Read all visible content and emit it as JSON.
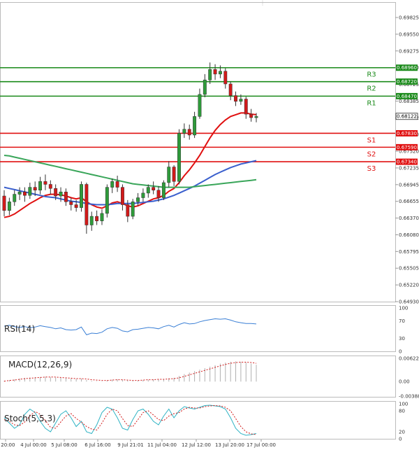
{
  "chart_data": {
    "type": "candlestick",
    "price_axis": {
      "ylim": [
        0.6493,
        0.69825
      ],
      "ticks": [
        "0.69825",
        "0.69550",
        "0.69275",
        "0.69000",
        "0.68725",
        "0.68385",
        "0.68122",
        "0.67860",
        "0.67520",
        "0.67235",
        "0.66945",
        "0.66655",
        "0.66370",
        "0.66080",
        "0.65795",
        "0.65505",
        "0.65220",
        "0.64930"
      ]
    },
    "x_ticks": [
      "n 20:00",
      "4 Jul 00:00",
      "5 Jul 08:00",
      "6 Jul 16:00",
      "9 Jul 21:01",
      "11 Jul 04:00",
      "12 Jul 12:00",
      "13 Jul 20:00",
      "17 Jul 00:00"
    ],
    "current_price": {
      "label": "0.68122",
      "value": 0.68122
    },
    "levels": [
      {
        "name": "R3",
        "value": 0.6896,
        "label": "0.68960",
        "color": "#1a8a1a"
      },
      {
        "name": "R2",
        "value": 0.6872,
        "label": "0.68720",
        "color": "#1a8a1a"
      },
      {
        "name": "R1",
        "value": 0.6847,
        "label": "0.68470",
        "color": "#1a8a1a"
      },
      {
        "name": "S1",
        "value": 0.6783,
        "label": "0.67830",
        "color": "#e01010"
      },
      {
        "name": "S2",
        "value": 0.6759,
        "label": "0.67590",
        "color": "#e01010"
      },
      {
        "name": "S3",
        "value": 0.6734,
        "label": "0.67340",
        "color": "#e01010"
      }
    ],
    "candles": [
      [
        0.6675,
        0.665,
        0.6685,
        0.664
      ],
      [
        0.665,
        0.6665,
        0.6672,
        0.6642
      ],
      [
        0.6665,
        0.6678,
        0.6685,
        0.6658
      ],
      [
        0.6678,
        0.6682,
        0.669,
        0.6668
      ],
      [
        0.6682,
        0.6676,
        0.669,
        0.6665
      ],
      [
        0.6676,
        0.669,
        0.6698,
        0.667
      ],
      [
        0.669,
        0.6685,
        0.67,
        0.6675
      ],
      [
        0.6685,
        0.67,
        0.6708,
        0.6678
      ],
      [
        0.67,
        0.6695,
        0.6712,
        0.6685
      ],
      [
        0.6695,
        0.6688,
        0.6702,
        0.6678
      ],
      [
        0.6688,
        0.6675,
        0.6695,
        0.6668
      ],
      [
        0.6675,
        0.6682,
        0.669,
        0.6665
      ],
      [
        0.6682,
        0.6665,
        0.6688,
        0.6658
      ],
      [
        0.6665,
        0.666,
        0.6672,
        0.665
      ],
      [
        0.666,
        0.6655,
        0.6668,
        0.6648
      ],
      [
        0.6655,
        0.6695,
        0.67,
        0.6648
      ],
      [
        0.6695,
        0.6625,
        0.6698,
        0.661
      ],
      [
        0.6625,
        0.664,
        0.6648,
        0.6615
      ],
      [
        0.664,
        0.6632,
        0.665,
        0.6625
      ],
      [
        0.6632,
        0.6645,
        0.6652,
        0.6625
      ],
      [
        0.6645,
        0.669,
        0.6695,
        0.6638
      ],
      [
        0.669,
        0.67,
        0.6705,
        0.668
      ],
      [
        0.67,
        0.669,
        0.671,
        0.6682
      ],
      [
        0.669,
        0.666,
        0.6695,
        0.665
      ],
      [
        0.666,
        0.664,
        0.6668,
        0.663
      ],
      [
        0.664,
        0.6665,
        0.667,
        0.6635
      ],
      [
        0.6665,
        0.6672,
        0.668,
        0.6658
      ],
      [
        0.6672,
        0.668,
        0.6688,
        0.6665
      ],
      [
        0.668,
        0.669,
        0.6695,
        0.6672
      ],
      [
        0.669,
        0.6685,
        0.67,
        0.6678
      ],
      [
        0.6685,
        0.6672,
        0.6692,
        0.6665
      ],
      [
        0.6672,
        0.6698,
        0.6702,
        0.6668
      ],
      [
        0.6698,
        0.6725,
        0.6735,
        0.669
      ],
      [
        0.6725,
        0.67,
        0.6728,
        0.6692
      ],
      [
        0.67,
        0.6783,
        0.679,
        0.6695
      ],
      [
        0.6783,
        0.679,
        0.68,
        0.6775
      ],
      [
        0.679,
        0.678,
        0.6798,
        0.6772
      ],
      [
        0.678,
        0.6812,
        0.682,
        0.6775
      ],
      [
        0.6812,
        0.685,
        0.686,
        0.6808
      ],
      [
        0.685,
        0.6875,
        0.6885,
        0.6845
      ],
      [
        0.6875,
        0.6893,
        0.6905,
        0.6868
      ],
      [
        0.6893,
        0.6885,
        0.6902,
        0.6875
      ],
      [
        0.6885,
        0.689,
        0.69,
        0.6878
      ],
      [
        0.689,
        0.6868,
        0.6895,
        0.686
      ],
      [
        0.6868,
        0.6848,
        0.6872,
        0.684
      ],
      [
        0.6848,
        0.6838,
        0.6855,
        0.683
      ],
      [
        0.6838,
        0.6842,
        0.685,
        0.6832
      ],
      [
        0.6842,
        0.6816,
        0.6846,
        0.6808
      ],
      [
        0.6816,
        0.681,
        0.6825,
        0.6803
      ],
      [
        0.681,
        0.6812,
        0.6818,
        0.6802
      ]
    ],
    "ma_series": [
      {
        "color": "#e01010",
        "values": [
          0.6638,
          0.664,
          0.6644,
          0.665,
          0.6656,
          0.6662,
          0.6667,
          0.6672,
          0.6676,
          0.6678,
          0.6678,
          0.6677,
          0.6675,
          0.6672,
          0.667,
          0.6672,
          0.6665,
          0.666,
          0.6656,
          0.6654,
          0.6658,
          0.6663,
          0.6665,
          0.6662,
          0.6658,
          0.6656,
          0.6658,
          0.6662,
          0.6666,
          0.667,
          0.6672,
          0.6676,
          0.6683,
          0.6688,
          0.6698,
          0.671,
          0.672,
          0.6732,
          0.6745,
          0.676,
          0.6775,
          0.6788,
          0.6798,
          0.6806,
          0.6812,
          0.6815,
          0.6818,
          0.6818,
          0.6816,
          0.6815
        ]
      },
      {
        "color": "#3a5fcd",
        "values": [
          0.669,
          0.6688,
          0.6686,
          0.6684,
          0.6682,
          0.668,
          0.6678,
          0.6676,
          0.6674,
          0.6673,
          0.6672,
          0.667,
          0.6668,
          0.6666,
          0.6665,
          0.6664,
          0.6662,
          0.6661,
          0.666,
          0.666,
          0.666,
          0.6661,
          0.6662,
          0.6662,
          0.6662,
          0.6662,
          0.6663,
          0.6664,
          0.6665,
          0.6666,
          0.6668,
          0.667,
          0.6673,
          0.6676,
          0.668,
          0.6684,
          0.6688,
          0.6692,
          0.6697,
          0.6702,
          0.6707,
          0.6712,
          0.6716,
          0.672,
          0.6724,
          0.6727,
          0.673,
          0.6732,
          0.6734,
          0.6736
        ]
      },
      {
        "color": "#3aa65a",
        "values": [
          0.6745,
          0.6744,
          0.6742,
          0.674,
          0.6738,
          0.6736,
          0.6734,
          0.6732,
          0.673,
          0.6728,
          0.6726,
          0.6724,
          0.6722,
          0.672,
          0.6718,
          0.6716,
          0.6714,
          0.6712,
          0.671,
          0.6708,
          0.6706,
          0.6704,
          0.6702,
          0.67,
          0.6698,
          0.6696,
          0.6695,
          0.6694,
          0.6693,
          0.6692,
          0.6691,
          0.669,
          0.669,
          0.669,
          0.669,
          0.669,
          0.669,
          0.6691,
          0.6692,
          0.6693,
          0.6694,
          0.6695,
          0.6696,
          0.6697,
          0.6698,
          0.6699,
          0.67,
          0.6701,
          0.6702,
          0.6703
        ]
      }
    ],
    "rsi": {
      "label": "RSI(14)",
      "ticks": [
        "100",
        "70",
        "30",
        "0"
      ],
      "values": [
        58,
        60,
        57,
        55,
        57,
        54,
        56,
        59,
        57,
        55,
        52,
        54,
        50,
        49,
        50,
        56,
        38,
        42,
        41,
        44,
        52,
        55,
        53,
        47,
        45,
        50,
        51,
        53,
        55,
        54,
        52,
        57,
        60,
        56,
        62,
        66,
        63,
        64,
        68,
        71,
        73,
        75,
        74,
        75,
        72,
        68,
        66,
        64,
        64,
        63
      ]
    },
    "macd": {
      "label": "MACD(12,26,9)",
      "ticks": [
        "0.006221",
        "0.00",
        "-0.003883"
      ],
      "hist": [
        0.0002,
        0.0004,
        0.0006,
        0.0008,
        0.001,
        0.0011,
        0.0012,
        0.0012,
        0.0013,
        0.0012,
        0.0011,
        0.001,
        0.0009,
        0.0008,
        0.0007,
        0.0008,
        0.0004,
        0.0002,
        0.0001,
        0.0001,
        0.0003,
        0.0005,
        0.0006,
        0.0005,
        0.0003,
        0.0002,
        0.0003,
        0.0004,
        0.0005,
        0.0006,
        0.0006,
        0.0007,
        0.0009,
        0.001,
        0.0015,
        0.002,
        0.0024,
        0.0028,
        0.0032,
        0.0036,
        0.004,
        0.0044,
        0.0048,
        0.0051,
        0.0053,
        0.0054,
        0.0053,
        0.0051,
        0.0048,
        0.0045
      ],
      "signal": [
        0.0001,
        0.0003,
        0.0004,
        0.0006,
        0.0008,
        0.0009,
        0.001,
        0.0011,
        0.0012,
        0.0012,
        0.0012,
        0.0011,
        0.001,
        0.0009,
        0.0008,
        0.0008,
        0.0007,
        0.0005,
        0.0004,
        0.0003,
        0.0003,
        0.0004,
        0.0005,
        0.0005,
        0.0004,
        0.0003,
        0.0003,
        0.0004,
        0.0005,
        0.0005,
        0.0006,
        0.0006,
        0.0007,
        0.0008,
        0.001,
        0.0014,
        0.0018,
        0.0022,
        0.0026,
        0.003,
        0.0034,
        0.0038,
        0.0042,
        0.0046,
        0.0049,
        0.0051,
        0.0052,
        0.0052,
        0.0051,
        0.0049
      ]
    },
    "stoch": {
      "label": "Stoch(5,5,3)",
      "ticks": [
        "100",
        "80",
        "20",
        "0"
      ],
      "k": [
        60,
        45,
        30,
        40,
        70,
        85,
        75,
        50,
        30,
        20,
        45,
        70,
        80,
        60,
        35,
        50,
        20,
        15,
        40,
        75,
        90,
        85,
        60,
        30,
        25,
        55,
        80,
        85,
        70,
        50,
        40,
        65,
        85,
        60,
        80,
        92,
        88,
        85,
        90,
        95,
        96,
        94,
        92,
        85,
        60,
        30,
        15,
        10,
        12,
        15
      ],
      "d": [
        55,
        50,
        40,
        38,
        48,
        65,
        78,
        70,
        52,
        33,
        30,
        48,
        65,
        72,
        58,
        48,
        35,
        28,
        25,
        45,
        70,
        85,
        80,
        58,
        38,
        35,
        55,
        75,
        80,
        68,
        55,
        52,
        65,
        72,
        75,
        85,
        90,
        88,
        88,
        92,
        94,
        95,
        94,
        90,
        80,
        58,
        35,
        20,
        14,
        12
      ]
    }
  }
}
